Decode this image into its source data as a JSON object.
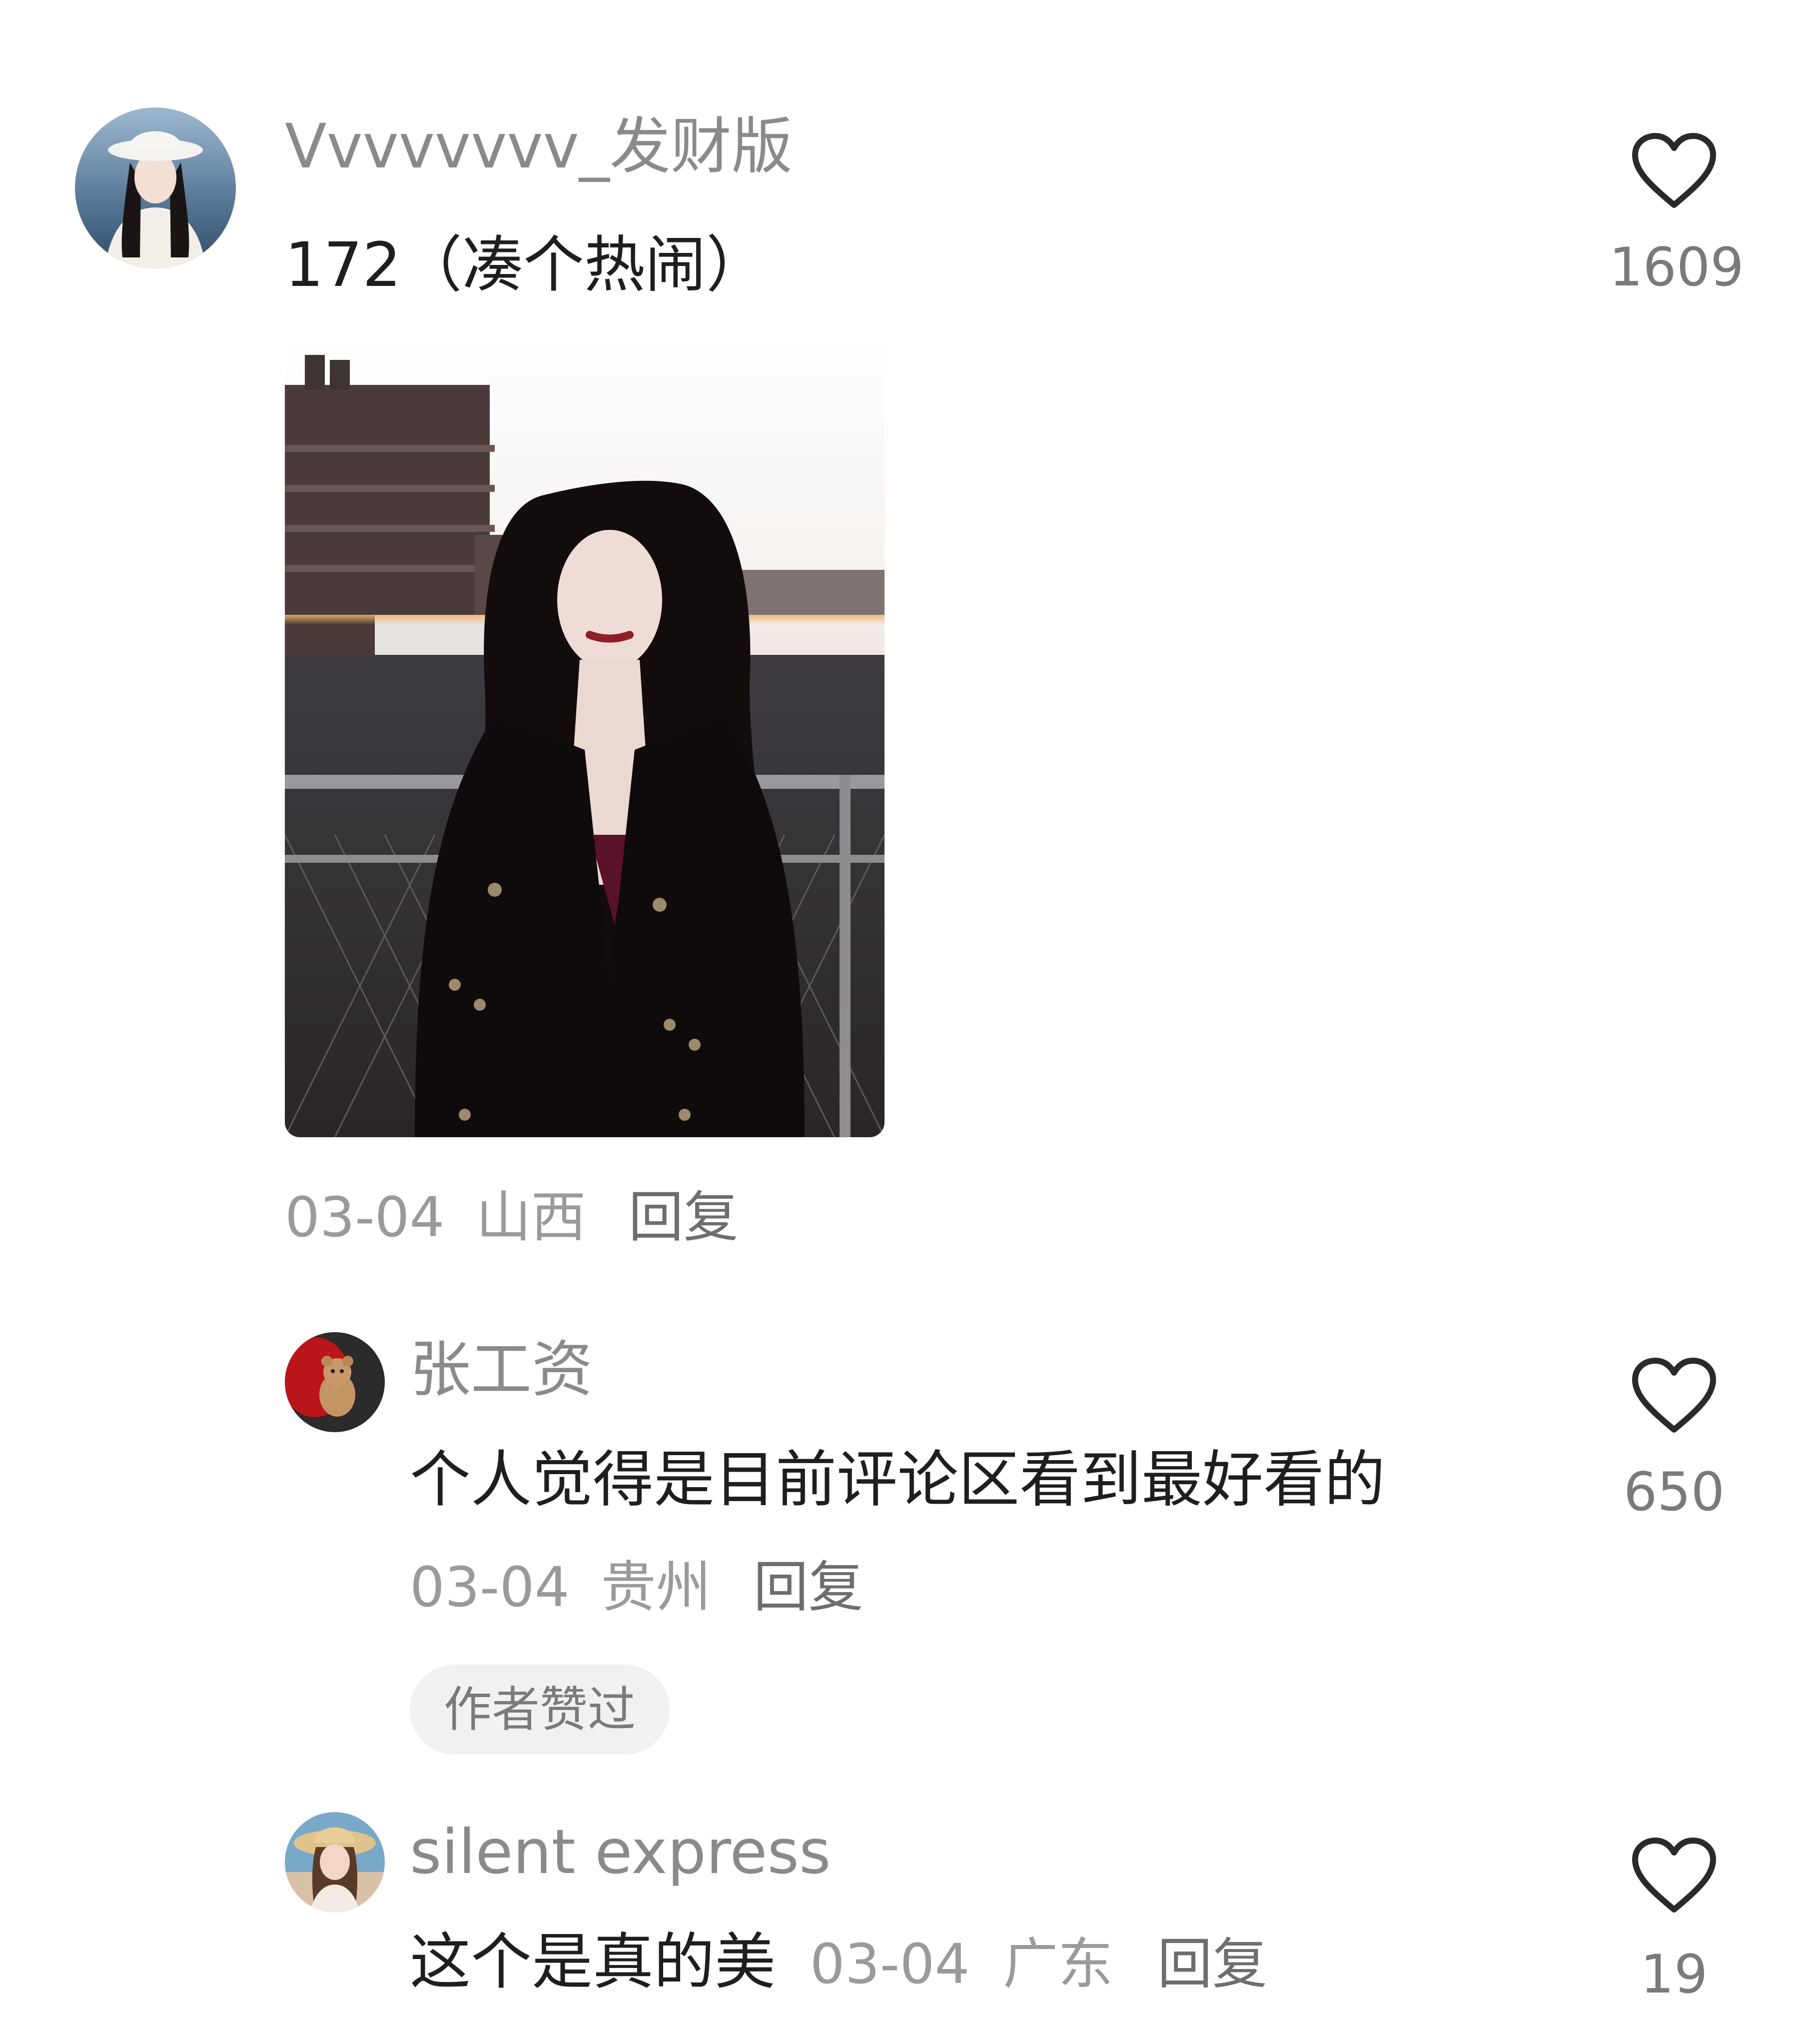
{
  "comments": [
    {
      "user": "Vvvvvvvv_发财版",
      "text": "172（凑个热闹）",
      "likes": "1609",
      "date": "03-04",
      "location": "山西",
      "reply_label": "回复",
      "has_photo": true
    },
    {
      "user": "张工资",
      "text": "个人觉得是目前评论区看到最好看的",
      "likes": "650",
      "date": "03-04",
      "location": "贵州",
      "reply_label": "回复",
      "badge": "作者赞过"
    },
    {
      "user": "silent express",
      "text": "这个是真的美",
      "likes": "19",
      "date": "03-04",
      "location": "广东",
      "reply_label": "回复"
    }
  ],
  "icons": {
    "like": "heart-outline-icon"
  },
  "colors": {
    "username": "#8a8a8a",
    "body_text": "#1e1e1e",
    "meta_text": "#9a9a9a",
    "badge_bg": "#f1f1f1"
  }
}
